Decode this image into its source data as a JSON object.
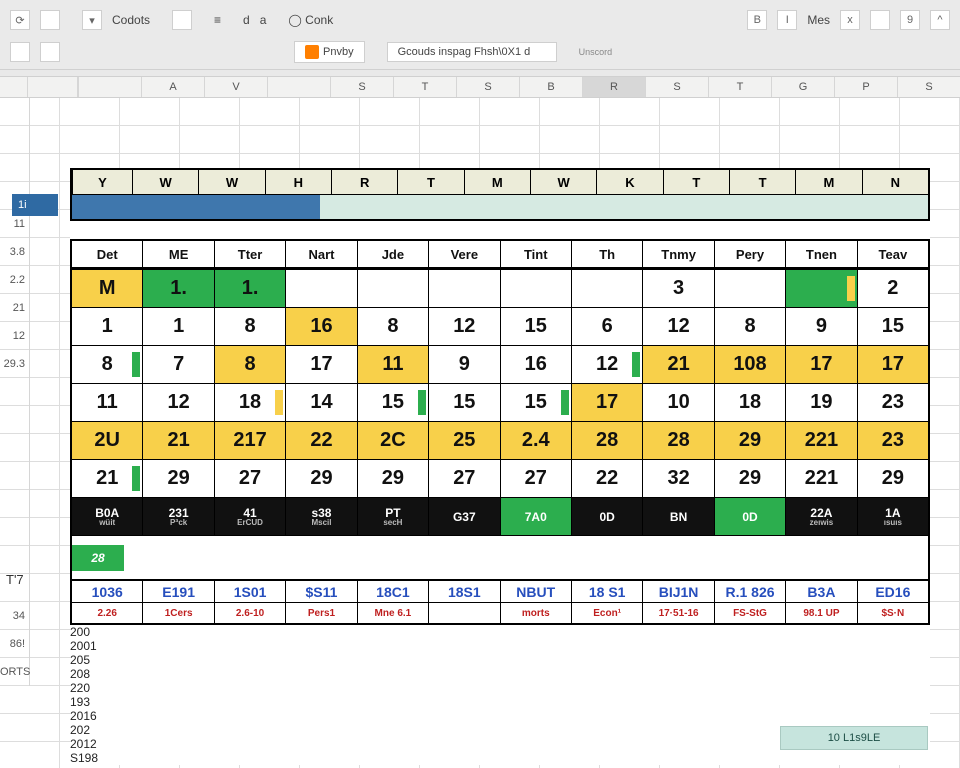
{
  "ribbon": {
    "top": {
      "redo_glyph": "⟳",
      "small_box_1": "",
      "codots_label": "Codots",
      "small_box_2": "",
      "small_d": "d",
      "small_a": "a",
      "small_o_conk": "◯ Conk",
      "group_right": {
        "b": "B",
        "i": "I",
        "mes_label": "Mes",
        "x": "x",
        "box": "",
        "num9": "9",
        "caret": "^"
      }
    },
    "bottom": {
      "privacy_label": "Pnvby",
      "gcouds_label": "Gcouds inspag Fhsh\\0X1 d",
      "underscore_label": "Unscord"
    }
  },
  "col_letters": [
    "",
    "A",
    "V",
    "",
    "S",
    "T",
    "S",
    "B",
    "R",
    "S",
    "T",
    "G",
    "P",
    "S"
  ],
  "gutter_numbers": [
    "11",
    "3.8",
    "2.2",
    "21",
    "12",
    "29.3",
    "",
    "",
    "",
    "",
    "",
    "",
    "",
    "",
    "34",
    "86!",
    "ORTS"
  ],
  "blue_label": "1i",
  "band_header": [
    "Y",
    "W",
    "W",
    "H",
    "R",
    "T",
    "M",
    "W",
    "K",
    "T",
    "T",
    "M",
    "N"
  ],
  "side_years": [
    "200",
    "2001",
    "205",
    "208",
    "220",
    "193",
    "",
    "2016",
    "",
    "202",
    "2012",
    "S198"
  ],
  "table_header": [
    "Det",
    "ME",
    "Tter",
    "Nart",
    "Jde",
    "Vere",
    "Tint",
    "Th",
    "Tnmy",
    "Pery",
    "Tnen",
    "Teav"
  ],
  "rows": [
    {
      "year": "200",
      "cells": [
        "M",
        "1.",
        "1.",
        "",
        "",
        "",
        "",
        "",
        "3",
        "",
        "",
        "2"
      ],
      "styles": [
        "m-red",
        "green",
        "green",
        "",
        "",
        "",
        "",
        "",
        "",
        "",
        "green yellowmark",
        ""
      ]
    },
    {
      "year": "2001",
      "cells": [
        "1",
        "1",
        "8",
        "16",
        "8",
        "12",
        "15",
        "6",
        "12",
        "8",
        "9",
        "15"
      ],
      "styles": [
        "",
        "",
        "",
        "yellow",
        "",
        "",
        "",
        "",
        "",
        "",
        "",
        ""
      ]
    },
    {
      "year": "205",
      "cells": [
        "8",
        "7",
        "8",
        "17",
        "11",
        "9",
        "16",
        "12",
        "21",
        "108",
        "17",
        "17"
      ],
      "styles": [
        "greenmark",
        "",
        "yellow",
        "",
        "yellow",
        "",
        "",
        "greenmark",
        "yellow",
        "yellow",
        "yellow",
        "yellow"
      ]
    },
    {
      "year": "208",
      "cells": [
        "11",
        "12",
        "18",
        "14",
        "15",
        "15",
        "15",
        "17",
        "10",
        "18",
        "19",
        "23"
      ],
      "styles": [
        "",
        "",
        "yellowmark",
        "",
        "greenmark",
        "",
        "greenmark",
        "yellow",
        "",
        "",
        "",
        ""
      ]
    },
    {
      "year": "220",
      "cells": [
        "2U",
        "21",
        "217",
        "22",
        "2C",
        "25",
        "2.4",
        "28",
        "28",
        "29",
        "221",
        "23"
      ],
      "rowstyle": "yellow-row",
      "styles": [
        "",
        "",
        "",
        "",
        "",
        "",
        "",
        "",
        "",
        "",
        "",
        ""
      ]
    },
    {
      "year": "193",
      "cells": [
        "21",
        "29",
        "27",
        "29",
        "29",
        "27",
        "27",
        "22",
        "32",
        "29",
        "221",
        "29"
      ],
      "styles": [
        "greenmark",
        "",
        "",
        "",
        "",
        "",
        "",
        "",
        "",
        "",
        "",
        ""
      ]
    }
  ],
  "dark_row": {
    "cells": [
      "B0A",
      "231",
      "41",
      "s38",
      "PT",
      "G37",
      "7A0",
      "0D",
      "BN",
      "0D",
      "22A",
      "1A"
    ],
    "subs": [
      "wüit",
      "Pªck",
      "ErCUD",
      "Mscil",
      "secH",
      "",
      "",
      "",
      "",
      "",
      "zeıwis",
      "ısuıs"
    ],
    "green_idx": [
      6,
      9
    ]
  },
  "tag_year": "2016",
  "tag_label": "28",
  "blue_ids": [
    "1036",
    "E191",
    "1S01",
    "$S11",
    "18C1",
    "18S1",
    "NBUT",
    "18 S1",
    "BIJ1N",
    "R.1 826",
    "B3A",
    "ED16"
  ],
  "red_ids": [
    "2.26",
    "1Cers",
    "2.6-10",
    "Pers1",
    "Mne 6.1",
    "",
    "morts",
    "Econ¹",
    "17·51-16",
    "FS-StG",
    "98.1 UP",
    "$S·N"
  ],
  "pale_strip": "10 L1s9LE",
  "extra_left_T7": "T'7"
}
